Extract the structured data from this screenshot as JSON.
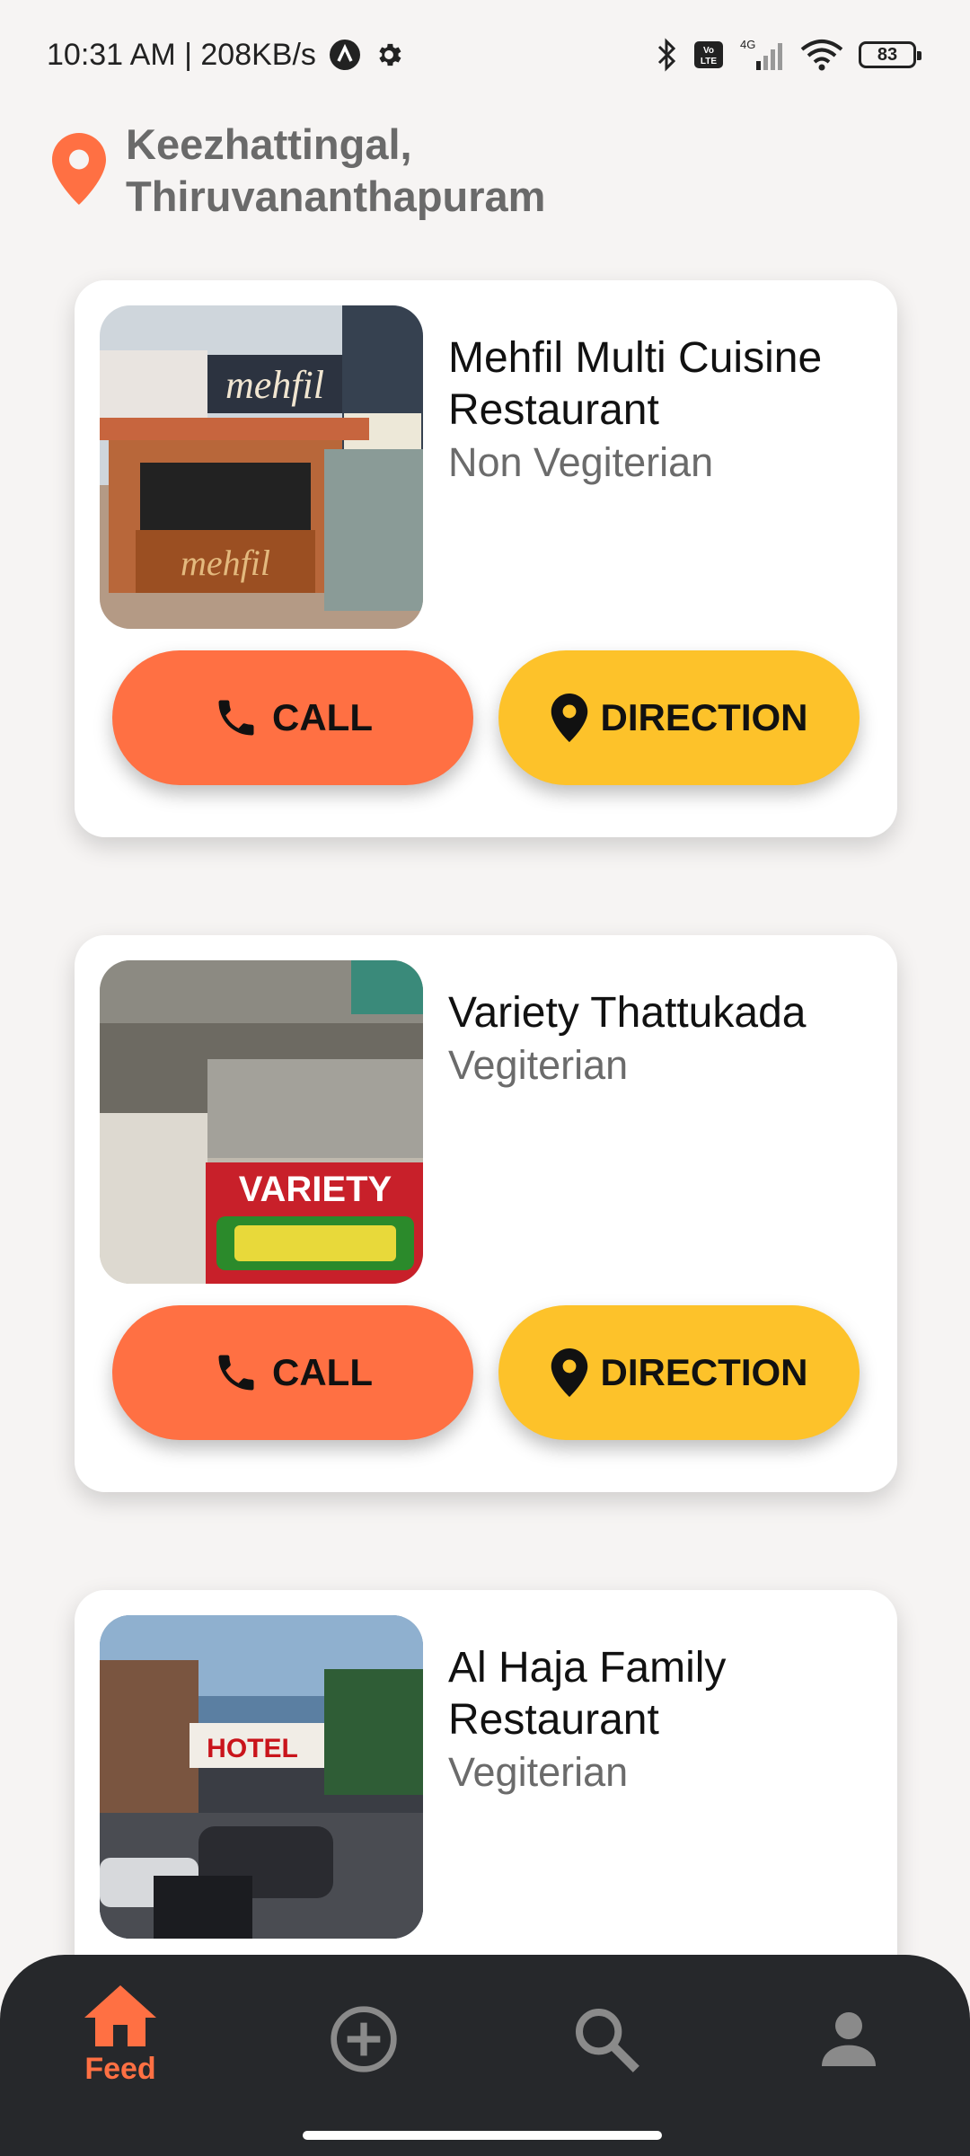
{
  "status_bar": {
    "time_speed": "10:31 AM | 208KB/s",
    "network_label": "4G",
    "volte_label": "Vo LTE",
    "battery": "83"
  },
  "location": {
    "line1": "Keezhattingal,",
    "line2": "Thiruvananthapuram",
    "icon": "location-pin-icon",
    "color": "#ff7043"
  },
  "restaurants": [
    {
      "name": "Mehfil Multi Cuisine Restaurant",
      "type": "Non Vegiterian",
      "sign_text": "mehfil"
    },
    {
      "name": "Variety Thattukada",
      "type": "Vegiterian",
      "sign_text": "VARIETY"
    },
    {
      "name": "Al Haja Family Restaurant",
      "type": "Vegiterian",
      "sign_text": "HOTEL"
    }
  ],
  "buttons": {
    "call_label": "CALL",
    "direction_label": "DIRECTION",
    "call_color": "#ff7043",
    "direction_color": "#fdc22a"
  },
  "bottom_nav": {
    "items": [
      {
        "label": "Feed",
        "icon": "home-icon",
        "active": true
      },
      {
        "label": "",
        "icon": "add-circle-icon",
        "active": false
      },
      {
        "label": "",
        "icon": "search-icon",
        "active": false
      },
      {
        "label": "",
        "icon": "profile-icon",
        "active": false
      }
    ],
    "active_color": "#ff7043",
    "inactive_color": "#8a8a8a"
  }
}
